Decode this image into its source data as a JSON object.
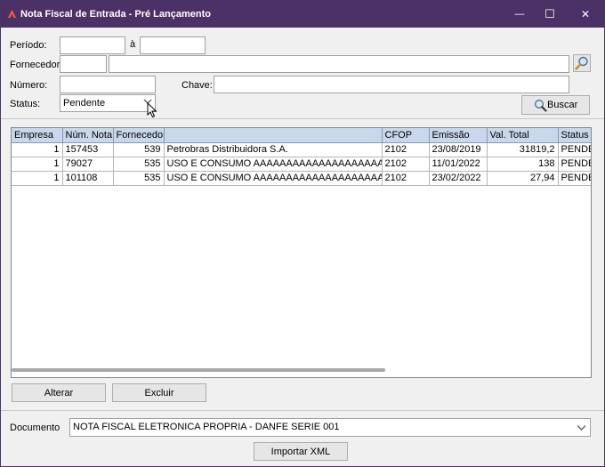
{
  "window": {
    "title": "Nota Fiscal de Entrada - Pré Lançamento",
    "minimize_glyph": "—",
    "maximize_glyph": "☐",
    "close_glyph": "✕"
  },
  "filters": {
    "periodo_label": "Período:",
    "periodo_start": "",
    "periodo_sep": "à",
    "periodo_end": "",
    "fornecedor_label": "Fornecedor:",
    "fornecedor_code": "",
    "fornecedor_name": "",
    "numero_label": "Número:",
    "numero_value": "",
    "chave_label": "Chave:",
    "chave_value": "",
    "status_label": "Status:",
    "status_value": "Pendente",
    "buscar_label": "Buscar"
  },
  "grid": {
    "columns": [
      "Empresa",
      "Núm. Nota",
      "Fornecedor",
      "",
      "CFOP",
      "Emissão",
      "Val. Total",
      "Status"
    ],
    "rows": [
      [
        "1",
        "157453",
        "539",
        "Petrobras Distribuidora S.A.",
        "2102",
        "23/08/2019",
        "31819,2",
        "PENDENTE"
      ],
      [
        "1",
        "79027",
        "535",
        "USO E CONSUMO AAAAAAAAAAAAAAAAAAAAAAAAAAA",
        "2102",
        "11/01/2022",
        "138",
        "PENDENTE"
      ],
      [
        "1",
        "101108",
        "535",
        "USO E CONSUMO AAAAAAAAAAAAAAAAAAAAAAAAAAA",
        "2102",
        "23/02/2022",
        "27,94",
        "PENDENTE"
      ]
    ]
  },
  "actions": {
    "alterar_label": "Alterar",
    "excluir_label": "Excluir"
  },
  "documento": {
    "label": "Documento",
    "value": "NOTA FISCAL ELETRONICA PROPRIA - DANFE SERIE 001"
  },
  "importar_label": "Importar XML",
  "colors": {
    "titlebar": "#4b3166",
    "grid_header": "#c9d7ec"
  }
}
